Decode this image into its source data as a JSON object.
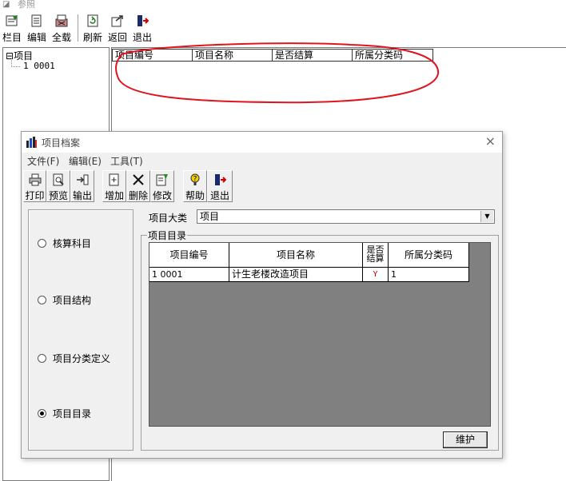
{
  "main": {
    "title": "参照",
    "toolbar": [
      {
        "label": "栏目",
        "icon": "column-icon"
      },
      {
        "label": "编辑",
        "icon": "edit-icon"
      },
      {
        "label": "全载",
        "icon": "load-all-icon"
      },
      {
        "label": "刷新",
        "icon": "refresh-icon"
      },
      {
        "label": "返回",
        "icon": "return-icon"
      },
      {
        "label": "退出",
        "icon": "exit-icon"
      }
    ],
    "tree": {
      "root": "项目",
      "root_toggle": "⊟",
      "child": "1 0001"
    },
    "list_headers": [
      "项目编号",
      "项目名称",
      "是否结算",
      "所属分类码"
    ]
  },
  "dialog": {
    "title": "项目档案",
    "close": "×",
    "menu": [
      "文件(F)",
      "编辑(E)",
      "工具(T)"
    ],
    "toolbar": [
      {
        "label": "打印",
        "icon": "print-icon"
      },
      {
        "label": "预览",
        "icon": "preview-icon"
      },
      {
        "label": "输出",
        "icon": "export-icon"
      },
      {
        "label": "增加",
        "icon": "add-icon"
      },
      {
        "label": "删除",
        "icon": "delete-icon"
      },
      {
        "label": "修改",
        "icon": "modify-icon"
      },
      {
        "label": "帮助",
        "icon": "help-icon"
      },
      {
        "label": "退出",
        "icon": "exit-icon"
      }
    ],
    "options": [
      {
        "label": "核算科目",
        "selected": false
      },
      {
        "label": "项目结构",
        "selected": false
      },
      {
        "label": "项目分类定义",
        "selected": false
      },
      {
        "label": "项目目录",
        "selected": true
      }
    ],
    "category_label": "项目大类",
    "category_value": "项目",
    "group_title": "项目目录",
    "grid": {
      "headers": [
        "项目编号",
        "项目名称",
        "是否结算",
        "所属分类码"
      ],
      "settle_header_lines": [
        "是否",
        "结算"
      ],
      "rows": [
        {
          "code": "1 0001",
          "name": "计生老楼改造项目",
          "settled": "Y",
          "class_code": "1"
        }
      ]
    },
    "maintain_button": "维护"
  },
  "colors": {
    "annotation_red": "#e0141e",
    "grid_background": "#808080",
    "dialog_background": "#f0f0f0"
  }
}
